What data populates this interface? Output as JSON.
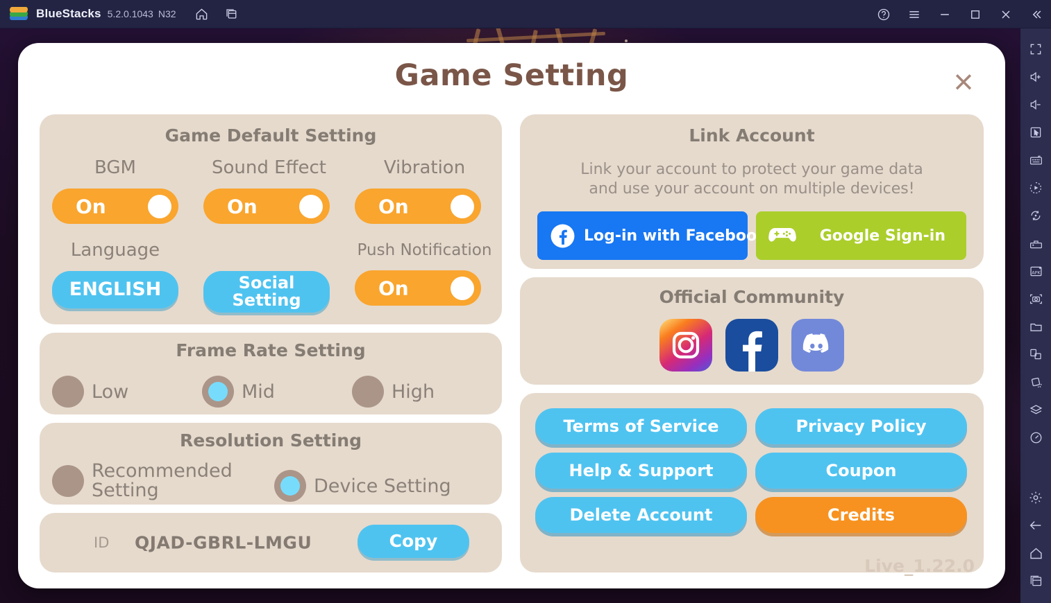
{
  "titlebar": {
    "app_name": "BlueStacks",
    "version": "5.2.0.1043",
    "instance": "N32",
    "icons": [
      "bluestacks-logo",
      "home-icon",
      "multi-instance-icon"
    ],
    "window_controls": [
      "help-icon",
      "menu-icon",
      "minimize-icon",
      "maximize-icon",
      "close-icon",
      "collapse-sidebar-icon"
    ]
  },
  "sidebar": {
    "icons": [
      "fullscreen-icon",
      "volume-up-icon",
      "volume-down-icon",
      "cursor-icon",
      "keyboard-controls-icon",
      "macro-recorder-icon",
      "rotate-icon",
      "gamepad-controls-icon",
      "install-apk-icon",
      "screenshot-icon",
      "media-folder-icon",
      "multi-instance-icon",
      "shake-icon",
      "layers-icon",
      "performance-icon"
    ],
    "bottom_icons": [
      "settings-gear-icon",
      "back-icon",
      "home-icon",
      "recents-icon"
    ]
  },
  "dialog": {
    "title": "Game Setting",
    "close_label": "×",
    "version": "Live_1.22.0"
  },
  "default_setting": {
    "title": "Game Default Setting",
    "labels": {
      "bgm": "BGM",
      "sound_effect": "Sound Effect",
      "vibration": "Vibration",
      "language": "Language",
      "push_notification": "Push Notification"
    },
    "toggles": {
      "bgm": "On",
      "sound_effect": "On",
      "vibration": "On",
      "push_notification": "On"
    },
    "language_value": "ENGLISH",
    "social_setting_label_line1": "Social",
    "social_setting_label_line2": "Setting"
  },
  "frame_rate": {
    "title": "Frame Rate Setting",
    "options": [
      {
        "label": "Low",
        "selected": false
      },
      {
        "label": "Mid",
        "selected": true
      },
      {
        "label": "High",
        "selected": false
      }
    ]
  },
  "resolution": {
    "title": "Resolution Setting",
    "options": [
      {
        "label_line1": "Recommended",
        "label_line2": "Setting",
        "selected": false
      },
      {
        "label_line1": "Device Setting",
        "label_line2": "",
        "selected": true
      }
    ]
  },
  "account_id": {
    "label": "ID",
    "value": "QJAD-GBRL-LMGU",
    "copy_label": "Copy"
  },
  "link_account": {
    "title": "Link Account",
    "description_line1": "Link your account to protect your game data",
    "description_line2": "and use your account on multiple devices!",
    "facebook_label": "Log-in with Facebook",
    "google_label": "Google Sign-in"
  },
  "community": {
    "title": "Official Community",
    "items": [
      {
        "name": "instagram-icon"
      },
      {
        "name": "facebook-icon"
      },
      {
        "name": "discord-icon"
      }
    ]
  },
  "links": {
    "buttons": [
      {
        "label": "Terms of Service",
        "accent": false
      },
      {
        "label": "Privacy Policy",
        "accent": false
      },
      {
        "label": "Help & Support",
        "accent": false
      },
      {
        "label": "Coupon",
        "accent": false
      },
      {
        "label": "Delete Account",
        "accent": false
      },
      {
        "label": "Credits",
        "accent": true
      }
    ]
  },
  "colors": {
    "orange": "#F9A52E",
    "cyan": "#4FC3F0",
    "panel": "#E6DACD",
    "title_brown": "#7A5648",
    "facebook_blue": "#1877F2",
    "google_green": "#ABCE2B",
    "discord": "#7289DA",
    "accent_orange": "#F79220"
  }
}
